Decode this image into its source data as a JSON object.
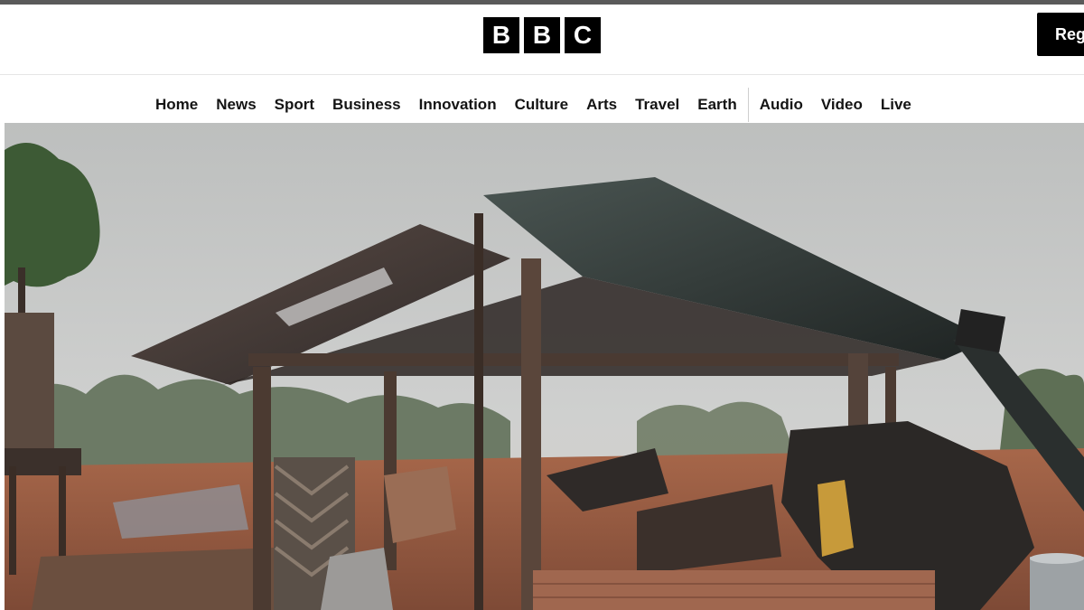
{
  "header": {
    "logo_letters": [
      "B",
      "B",
      "C"
    ],
    "register_label": "Reg"
  },
  "nav": {
    "items": [
      "Home",
      "News",
      "Sport",
      "Business",
      "Innovation",
      "Culture",
      "Arts",
      "Travel",
      "Earth",
      "Audio",
      "Video",
      "Live"
    ]
  },
  "hero": {
    "image_subject": "damaged-house-photo"
  }
}
